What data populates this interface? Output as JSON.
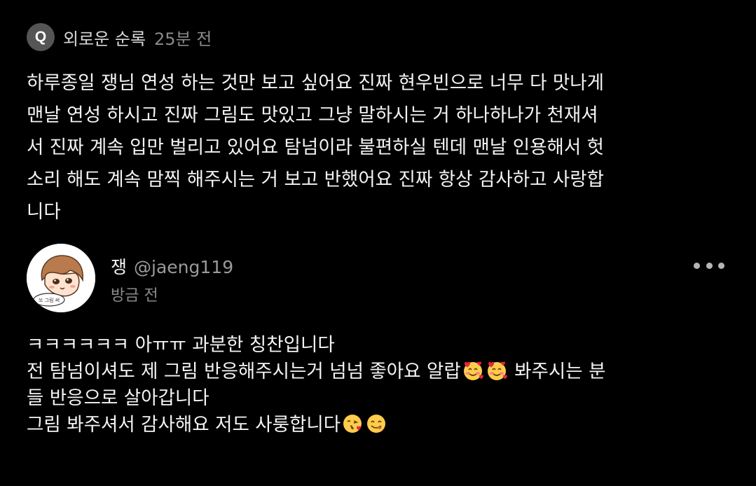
{
  "question_header": {
    "badge_label": "Q",
    "author": "외로운 순록",
    "time": "25분 전"
  },
  "question": {
    "text": "하루종일 쟁님 연성 하는 것만 보고 싶어요 진짜 현우빈으로 너무 다 맛나게\n맨날 연성 하시고 진짜 그림도 맛있고 그냥 말하시는 거 하나하나가 천재셔\n서 진짜 계속 입만 벌리고 있어요 탐넘이라 불편하실 텐데 맨날 인용해서 헛\n소리 해도 계속 맘찍 해주시는 거 보고 반했어요 진짜 항상 감사하고 사랑합\n니다"
  },
  "answer_header": {
    "display_name": "쟁",
    "handle": "@jaeng119",
    "time": "방금 전",
    "avatar_caption": "쏘 그림 써"
  },
  "answer": {
    "line1": "ㅋㅋㅋㅋㅋㅋ 아ㅠㅠ 과분한 칭찬입니다",
    "line2_before": "전 탐넘이셔도 제 그림 반응해주시는거 넘넘 좋아요 알랍",
    "line2_after": " 봐주시는 분",
    "line3": "들 반응으로 살아갑니다",
    "line4": "그림 봐주셔서 감사해요 저도 사룽합니다"
  },
  "icons": {
    "more": "more-options-icon",
    "emoji_hearts": "smiling-face-with-hearts-emoji",
    "emoji_kiss": "face-blowing-kiss-emoji",
    "emoji_yum": "face-savoring-food-emoji"
  },
  "colors": {
    "background": "#000000",
    "text": "#f4f4f4",
    "muted": "#8a8a8a",
    "badge": "#555555"
  }
}
